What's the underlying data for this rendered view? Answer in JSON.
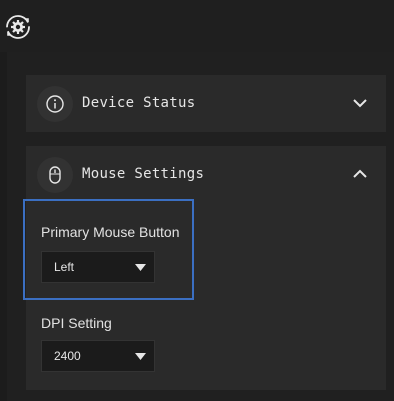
{
  "app": {
    "logo_icon": "gear-sync-icon"
  },
  "sections": {
    "device_status": {
      "title": "Device Status",
      "icon": "info-icon",
      "expanded": false,
      "toggle_icon": "chevron-down-icon"
    },
    "mouse_settings": {
      "title": "Mouse Settings",
      "icon": "mouse-icon",
      "expanded": true,
      "toggle_icon": "chevron-up-icon",
      "primary_button": {
        "label": "Primary Mouse Button",
        "value": "Left"
      },
      "dpi": {
        "label": "DPI Setting",
        "value": "2400"
      }
    }
  },
  "colors": {
    "highlight": "#3b6fc2",
    "background": "#1c1c1c",
    "card": "#2a2a2a"
  }
}
